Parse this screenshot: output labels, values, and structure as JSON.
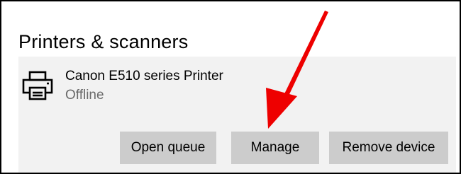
{
  "section": {
    "title": "Printers & scanners"
  },
  "device": {
    "icon": "printer-icon",
    "name": "Canon E510 series Printer",
    "status": "Offline",
    "buttons": {
      "open_queue": "Open queue",
      "manage": "Manage",
      "remove_device": "Remove device"
    }
  },
  "colors": {
    "card_background": "#f2f2f2",
    "button_background": "#cccccc",
    "status_text": "#6b6b6b",
    "annotation_arrow": "#ee0000"
  }
}
